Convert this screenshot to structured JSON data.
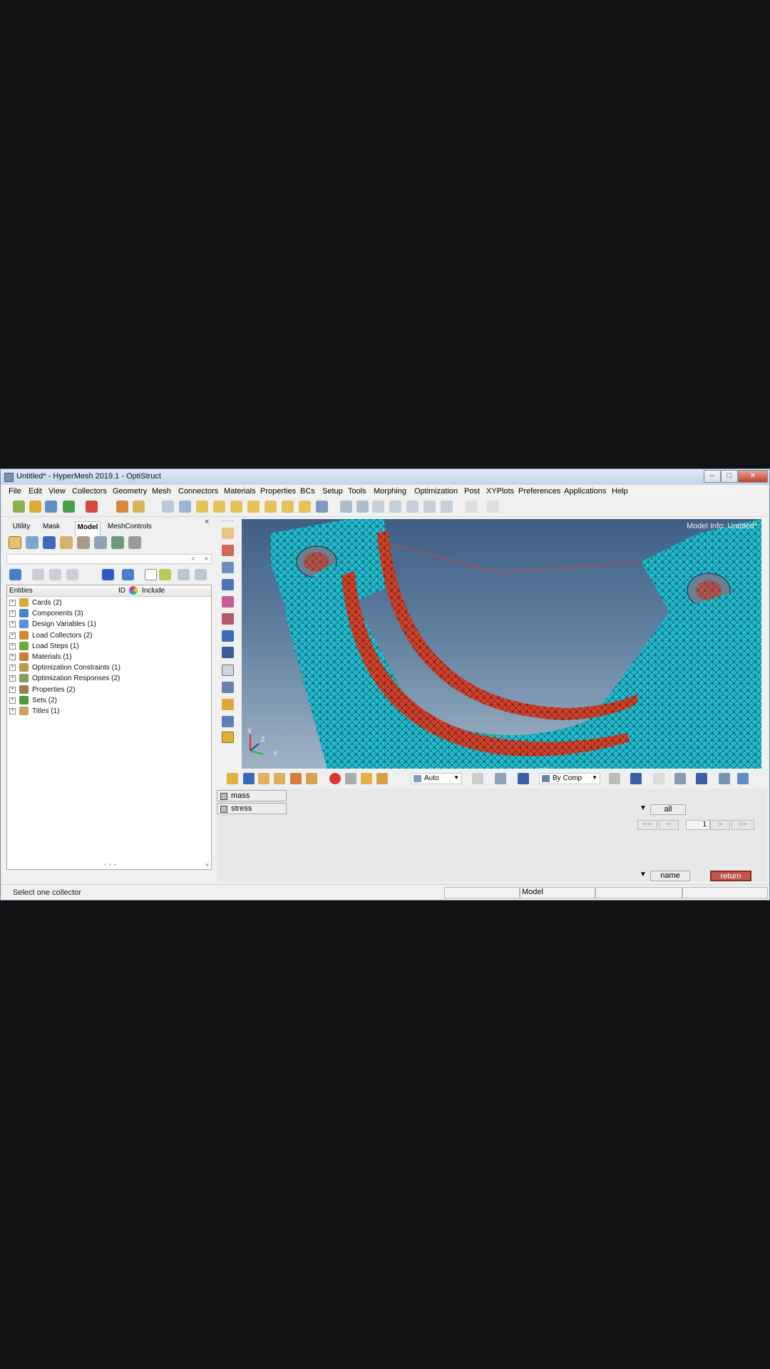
{
  "window": {
    "title": "Untitled* - HyperMesh 2019.1 - OptiStruct",
    "controls": {
      "minimize": "–",
      "maximize": "□",
      "close": "×"
    }
  },
  "menu": [
    "File",
    "Edit",
    "View",
    "Collectors",
    "Geometry",
    "Mesh",
    "Connectors",
    "Materials",
    "Properties",
    "BCs",
    "Setup",
    "Tools",
    "Morphing",
    "Optimization",
    "Post",
    "XYPlots",
    "Preferences",
    "Applications",
    "Help"
  ],
  "tabs": [
    "Utility",
    "Mask",
    "Model",
    "MeshControls"
  ],
  "active_tab": "Model",
  "panel_close": "×",
  "browser": {
    "headers": {
      "entities": "Entities",
      "id": "ID",
      "include": "Include"
    },
    "expand_symbol": "+",
    "items": [
      {
        "label": "Cards (2)",
        "icon": "cards-icon",
        "color": "#d8a640"
      },
      {
        "label": "Components (3)",
        "icon": "components-icon",
        "color": "#4a7fc9"
      },
      {
        "label": "Design Variables (1)",
        "icon": "design-variables-icon",
        "color": "#5a8ed6"
      },
      {
        "label": "Load Collectors (2)",
        "icon": "load-collectors-icon",
        "color": "#d08a30"
      },
      {
        "label": "Load Steps (1)",
        "icon": "load-steps-icon",
        "color": "#6aa83c"
      },
      {
        "label": "Materials (1)",
        "icon": "materials-icon",
        "color": "#c87c3a"
      },
      {
        "label": "Optimization Constraints (1)",
        "icon": "optimization-constraints-icon",
        "color": "#b89a50"
      },
      {
        "label": "Optimization Responses (2)",
        "icon": "optimization-responses-icon",
        "color": "#8a9a60"
      },
      {
        "label": "Properties (2)",
        "icon": "properties-icon",
        "color": "#9a7a50"
      },
      {
        "label": "Sets (2)",
        "icon": "sets-icon",
        "color": "#4f9a3f"
      },
      {
        "label": "Titles (1)",
        "icon": "titles-icon",
        "color": "#c9a060"
      }
    ]
  },
  "graphics": {
    "model_info": "Model Info: Untitled*",
    "triad": {
      "x": "X",
      "z": "Z",
      "y": "Y"
    },
    "colors": {
      "mesh": "#22c4d6",
      "highlight": "#d9452e"
    }
  },
  "graphic_toolbar": {
    "render_mode": "Auto",
    "color_by": "By Comp"
  },
  "bottom_panel": {
    "list": [
      "mass",
      "stress"
    ],
    "filter": "all",
    "page_buttons": [
      "<<",
      "<",
      "1",
      ">",
      ">>"
    ],
    "sort": "name",
    "return_label": "return"
  },
  "status": {
    "message": "Select one collector",
    "field2": "Model"
  }
}
